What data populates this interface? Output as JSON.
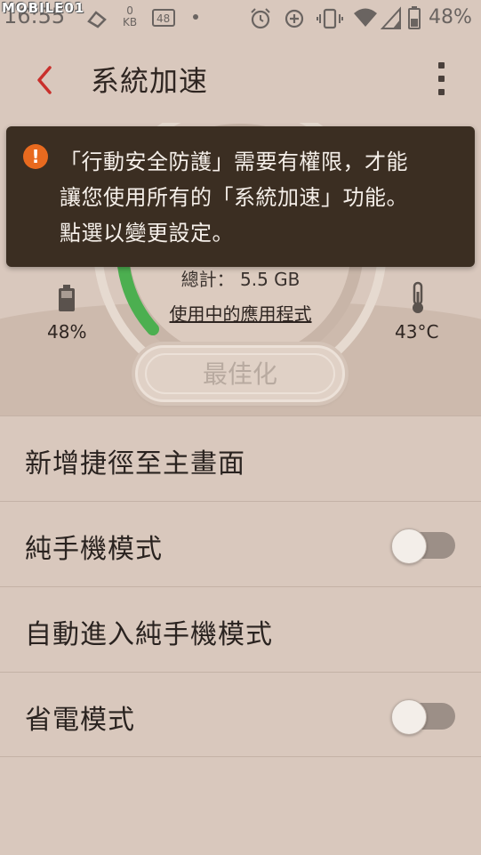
{
  "status_bar": {
    "time": "16:55",
    "watermark": "MOBILE01",
    "net_speed_value": "0",
    "net_speed_unit": "KB",
    "sim_label": "48",
    "battery_percent": "48%"
  },
  "app_bar": {
    "title": "系統加速"
  },
  "gauge": {
    "total": "總計： 5.5 GB",
    "apps_link": "使用中的應用程式",
    "battery_value": "48%",
    "temperature_value": "43°C",
    "optimize_label": "最佳化",
    "progress_color": "#4caf50"
  },
  "warning": {
    "lines": [
      "「行動安全防護」需要有權限，才能",
      "讓您使用所有的「系統加速」功能。",
      "點選以變更設定。"
    ],
    "icon_color": "#e86a1f"
  },
  "list": {
    "items": [
      {
        "label": "新增捷徑至主畫面"
      },
      {
        "label": "純手機模式",
        "toggle_on": false
      },
      {
        "label": "自動進入純手機模式"
      },
      {
        "label": "省電模式",
        "toggle_on": false
      }
    ]
  },
  "colors": {
    "accent": "#c9302c",
    "background": "#d9c8bd",
    "warning_bg": "#3b2e22"
  }
}
